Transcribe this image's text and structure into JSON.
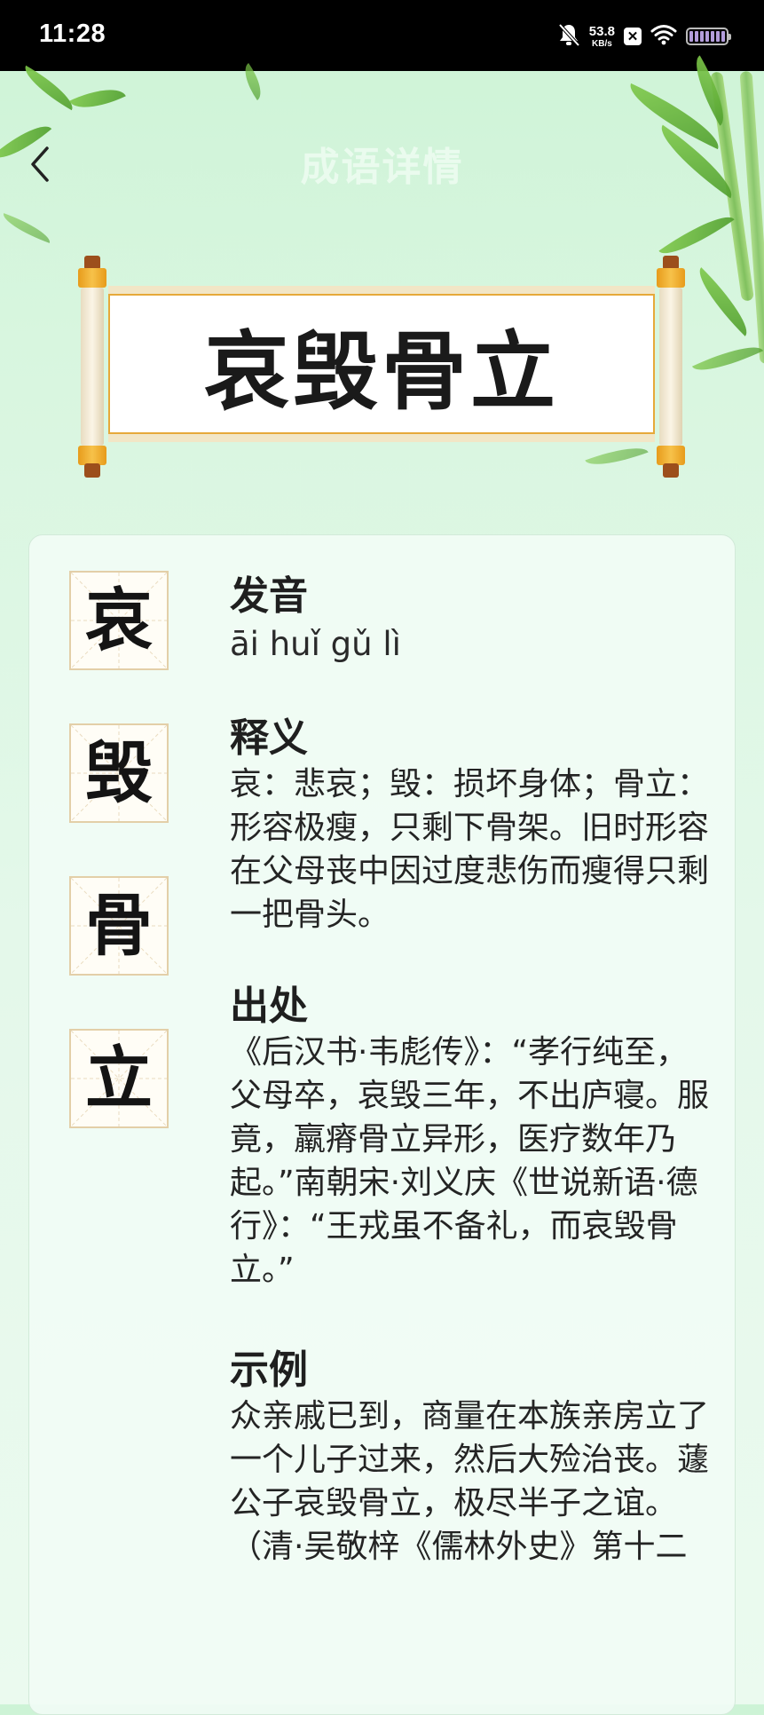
{
  "status_bar": {
    "time": "11:28",
    "net_speed_value": "53.8",
    "net_speed_unit": "KB/s",
    "x_badge": "✕",
    "icons": [
      "bell-off-icon",
      "x-badge-icon",
      "wifi-icon",
      "battery-icon"
    ]
  },
  "header": {
    "title": "成语详情",
    "back_icon": "chevron-left-icon"
  },
  "idiom": {
    "word": "哀毁骨立",
    "characters": [
      "哀",
      "毁",
      "骨",
      "立"
    ]
  },
  "sections": {
    "pronunciation": {
      "heading": "发音",
      "text": "āi huǐ gǔ lì"
    },
    "definition": {
      "heading": "释义",
      "text": "哀：悲哀；毁：损坏身体；骨立：形容极瘦，只剩下骨架。旧时形容在父母丧中因过度悲伤而瘦得只剩一把骨头。"
    },
    "source": {
      "heading": "出处",
      "text": "《后汉书·韦彪传》：“孝行纯至，父母卒，哀毁三年，不出庐寝。服竟，羸瘠骨立异形，医疗数年乃起。”南朝宋·刘义庆《世说新语·德行》：“王戎虽不备礼，而哀毁骨立。”"
    },
    "example": {
      "heading": "示例",
      "text": "众亲戚已到，商量在本族亲房立了一个儿子过来，然后大殓治丧。蘧公子哀毁骨立，极尽半子之谊。（清·吴敬梓《儒林外史》第十二"
    }
  },
  "colors": {
    "background": "#d8f6df",
    "scroll_gold": "#e79b1b",
    "scroll_wood": "#9c4f1c",
    "text_dark": "#1a1a1a"
  }
}
